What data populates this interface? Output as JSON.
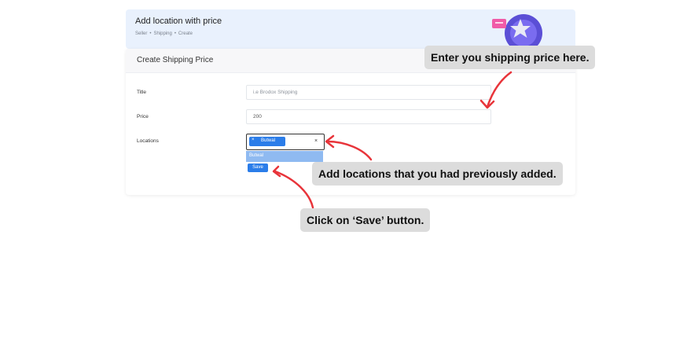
{
  "header": {
    "title": "Add location with price",
    "breadcrumb": [
      "Seller",
      "•",
      "Shipping",
      "•",
      "Create"
    ]
  },
  "card": {
    "title": "Create Shipping Price",
    "fields": {
      "title": {
        "label": "Title",
        "placeholder": "i.e Brodox Shipping"
      },
      "price": {
        "label": "Price",
        "value": "200"
      },
      "locations": {
        "label": "Locations",
        "selected_chip": "Butwal",
        "chip_remove": "×",
        "clear": "×",
        "dropdown_option": "Butwal"
      }
    },
    "save_label": "Save"
  },
  "callouts": {
    "price": "Enter you shipping price here.",
    "locations": "Add locations that you had previously added.",
    "save": "Click on ‘Save’ button."
  },
  "colors": {
    "accent": "#2b7de9",
    "banner_bg": "#e9f1fd",
    "callout_bg": "#dcdcdc",
    "arrow": "#e8343a"
  }
}
